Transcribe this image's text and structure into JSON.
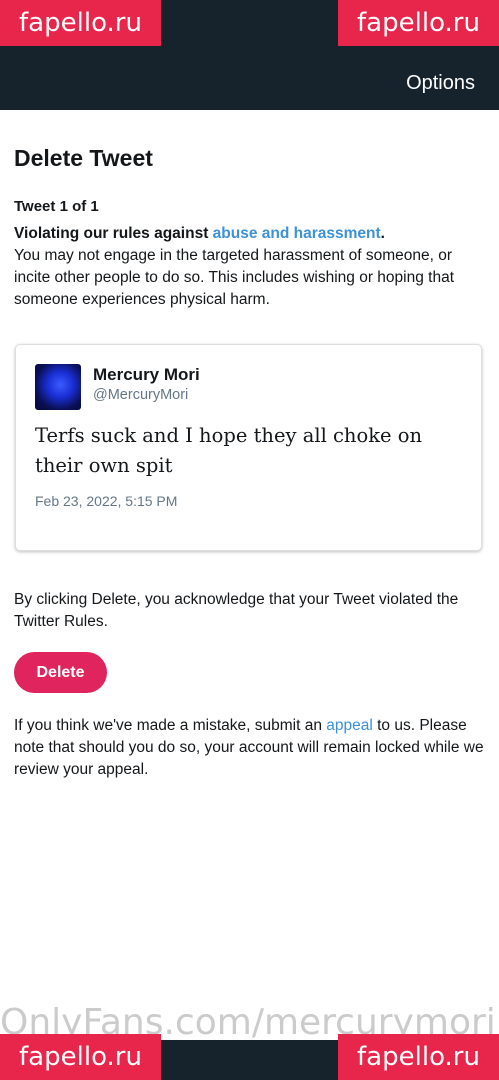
{
  "header": {
    "options_label": "Options"
  },
  "page": {
    "title": "Delete Tweet",
    "counter": "Tweet 1 of 1",
    "violation_prefix": "Violating our rules against ",
    "violation_link": "abuse and harassment",
    "violation_suffix": ".",
    "rule_description": "You may not engage in the targeted harassment of someone, or incite other people to do so. This includes wishing or hoping that someone experiences physical harm."
  },
  "tweet": {
    "author_name": "Mercury Mori",
    "author_handle": "@MercuryMori",
    "text": "Terfs suck and I hope they all choke on their own spit",
    "timestamp": "Feb 23, 2022, 5:15 PM"
  },
  "acknowledgement": "By clicking Delete, you acknowledge that your Tweet violated the Twitter Rules.",
  "delete_button_label": "Delete",
  "appeal": {
    "prefix": "If you think we've made a mistake, submit an ",
    "link": "appeal",
    "suffix": " to us. Please note that should you do so, your account will remain locked while we review your appeal."
  },
  "watermarks": {
    "corner_text": "fapello.ru",
    "bottom_text": "OnlyFans.com/mercurymori"
  },
  "colors": {
    "accent_link": "#3d91d6",
    "delete_button": "#e0245e",
    "header_bg": "#16232d"
  }
}
